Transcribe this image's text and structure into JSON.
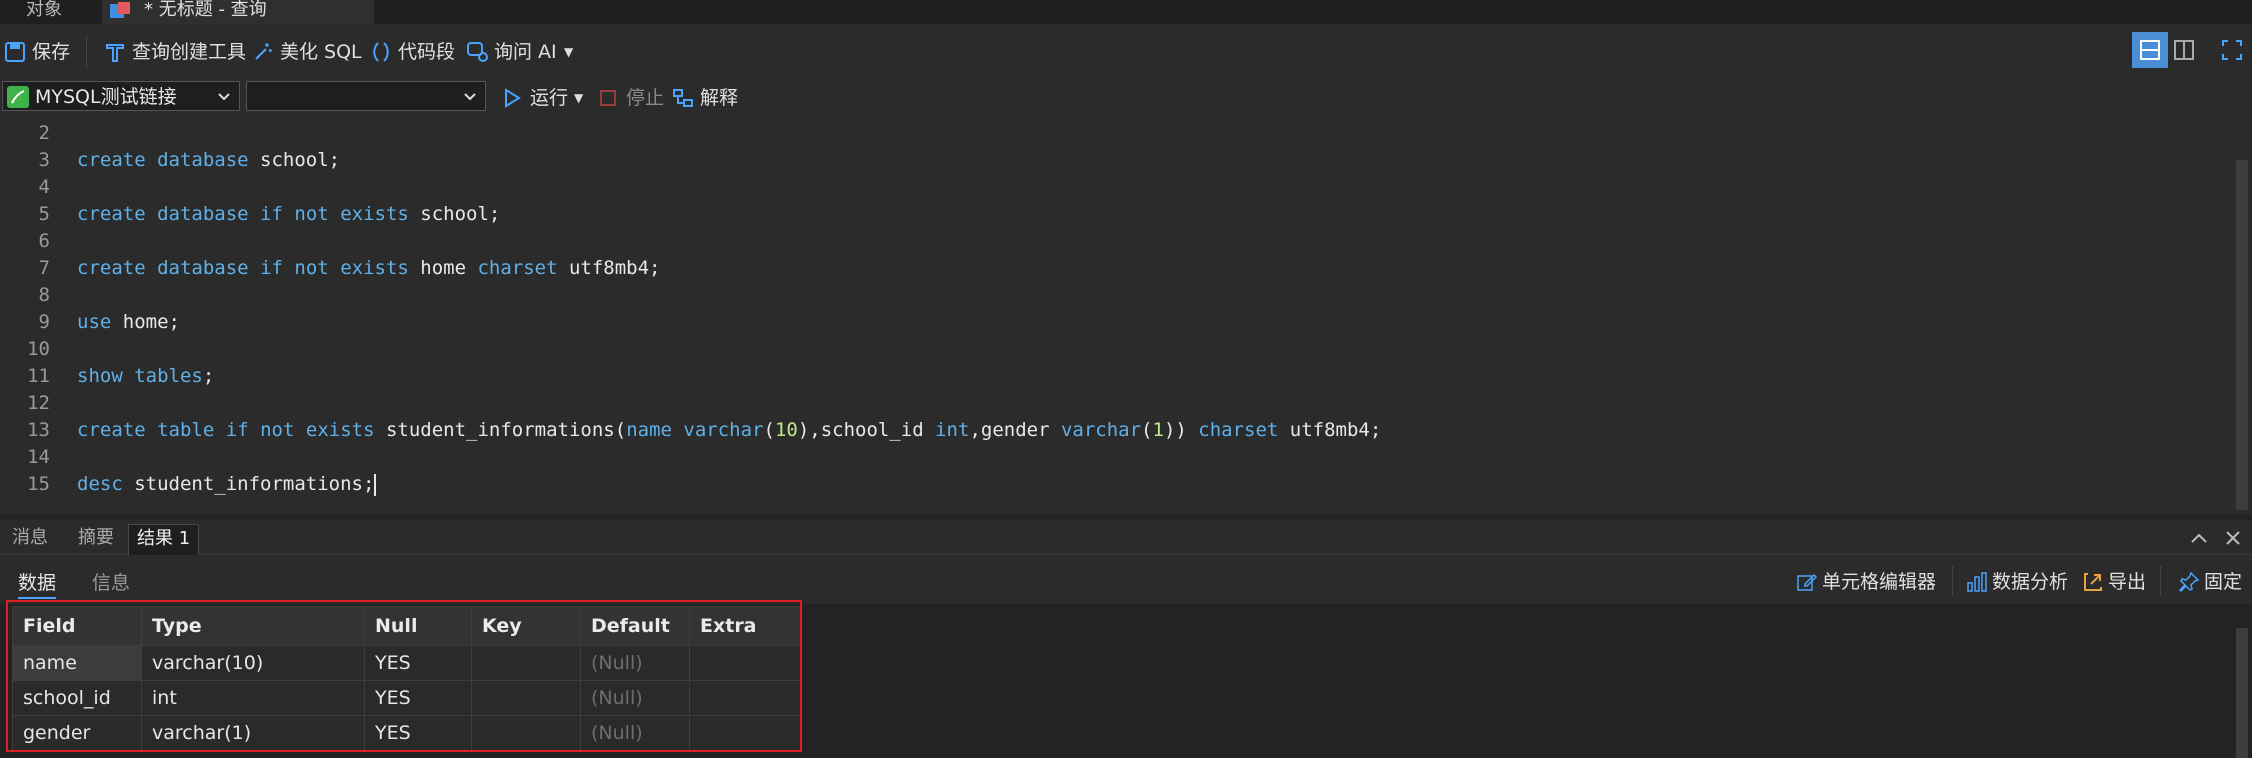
{
  "tabs": [
    {
      "label": "对象"
    },
    {
      "label": "* 无标题 - 查询"
    }
  ],
  "toolbar": {
    "save": "保存",
    "query_builder": "查询创建工具",
    "beautify_sql": "美化 SQL",
    "code_snippet": "代码段",
    "ask_ai": "询问 AI"
  },
  "connection": {
    "selected": "MYSQL测试链接",
    "database": ""
  },
  "run_toolbar": {
    "run": "运行",
    "stop": "停止",
    "explain": "解释"
  },
  "editor": {
    "line_numbers": [
      "2",
      "3",
      "4",
      "5",
      "6",
      "7",
      "8",
      "9",
      "10",
      "11",
      "12",
      "13",
      "14",
      "15"
    ]
  },
  "result_tabs": {
    "messages": "消息",
    "summary": "摘要",
    "result1": "结果 1"
  },
  "result_subtabs": {
    "data": "数据",
    "info": "信息",
    "cell_editor": "单元格编辑器",
    "data_analysis": "数据分析",
    "export": "导出",
    "pin": "固定"
  },
  "result_table": {
    "columns": [
      "Field",
      "Type",
      "Null",
      "Key",
      "Default",
      "Extra"
    ],
    "rows": [
      [
        "name",
        "varchar(10)",
        "YES",
        "",
        "(Null)",
        ""
      ],
      [
        "school_id",
        "int",
        "YES",
        "",
        "(Null)",
        ""
      ],
      [
        "gender",
        "varchar(1)",
        "YES",
        "",
        "(Null)",
        ""
      ]
    ]
  },
  "colors": {
    "keyword": "#5fb0e8",
    "number": "#c2e88c",
    "highlight_box": "#e01f25",
    "accent": "#4aa3ff"
  }
}
